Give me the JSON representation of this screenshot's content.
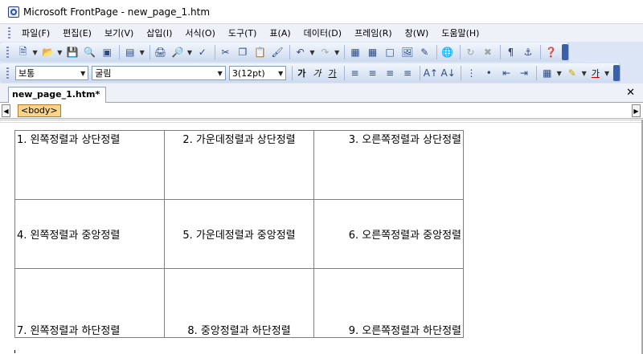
{
  "window": {
    "title": "Microsoft FrontPage - new_page_1.htm"
  },
  "menu": {
    "items": [
      "파일(F)",
      "편집(E)",
      "보기(V)",
      "삽입(I)",
      "서식(O)",
      "도구(T)",
      "표(A)",
      "데이터(D)",
      "프레임(R)",
      "창(W)",
      "도움말(H)"
    ]
  },
  "format_toolbar": {
    "style": "보통",
    "font": "굴림",
    "size": "3(12pt)",
    "bold": "가",
    "italic": "가",
    "underline": "가",
    "font_color": "가"
  },
  "tabs": {
    "document": "new_page_1.htm*",
    "tag": "<body>"
  },
  "table": {
    "rows": [
      [
        "1. 왼쪽정렬과 상단정렬",
        "2. 가운데정렬과 상단정렬",
        "3. 오른쪽정렬과 상단정렬"
      ],
      [
        "4. 왼쪽정렬과 중앙정렬",
        "5. 가운데정렬과 중앙정렬",
        "6. 오른쪽정렬과 중앙정렬"
      ],
      [
        "7. 왼쪽정렬과 하단정렬",
        "8. 중앙정렬과 하단정렬",
        "9. 오른쪽정렬과 하단정렬"
      ]
    ]
  },
  "colors": {
    "toolbar_bg": "#dbe5f5",
    "tag_highlight": "#f8d48a"
  }
}
